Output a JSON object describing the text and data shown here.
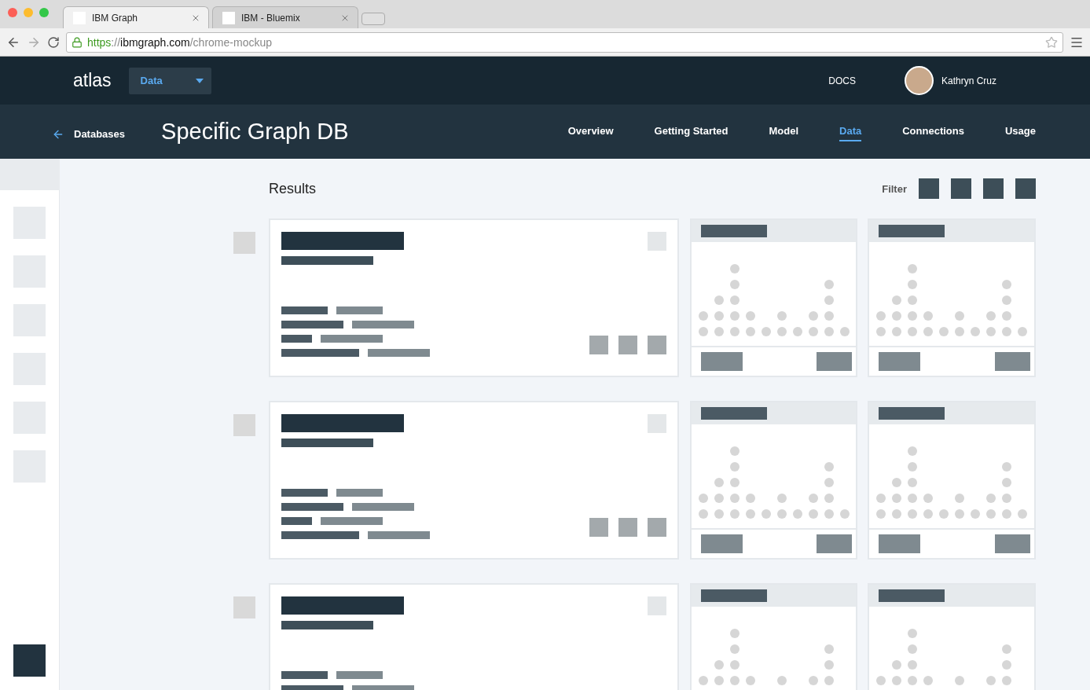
{
  "browser": {
    "tabs": [
      {
        "title": "IBM Graph",
        "selected": true
      },
      {
        "title": "IBM - Bluemix",
        "selected": false
      }
    ],
    "url": {
      "scheme": "https",
      "separator": "://",
      "host": "ibmgraph.com",
      "path": "/chrome-mockup"
    }
  },
  "app_bar": {
    "logo": "atlas",
    "section_menu": {
      "value": "Data"
    },
    "docs_link": "DOCS",
    "user": {
      "name": "Kathryn Cruz"
    }
  },
  "sub_nav": {
    "back_link": "Databases",
    "title": "Specific Graph DB",
    "tabs": [
      {
        "label": "Overview",
        "selected": false
      },
      {
        "label": "Getting Started",
        "selected": false
      },
      {
        "label": "Model",
        "selected": false
      },
      {
        "label": "Data",
        "selected": true
      },
      {
        "label": "Connections",
        "selected": false
      },
      {
        "label": "Usage",
        "selected": false
      }
    ]
  },
  "results": {
    "heading": "Results",
    "filter_label": "Filter"
  }
}
